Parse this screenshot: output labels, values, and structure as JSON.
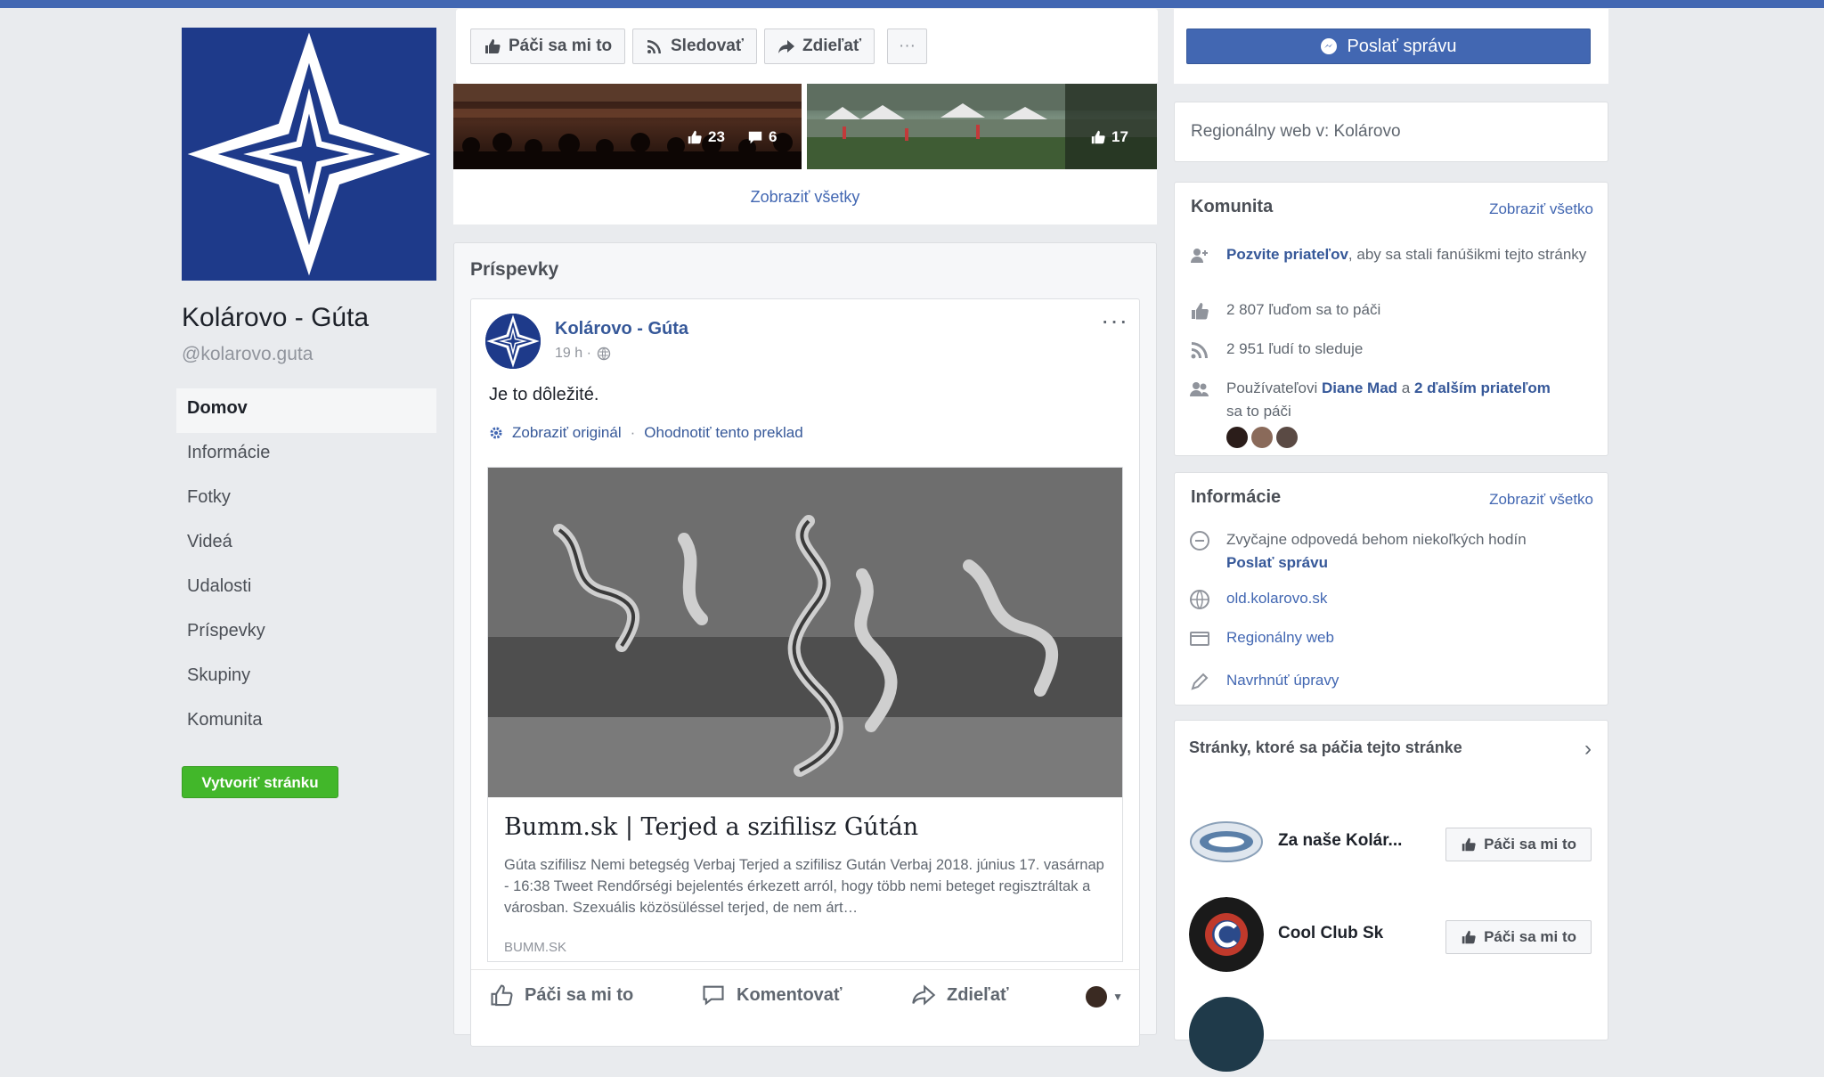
{
  "colors": {
    "accent": "#4267b2",
    "link": "#365899",
    "create_button": "#42b72a",
    "background": "#e9ebee"
  },
  "page": {
    "name": "Kolárovo - Gúta",
    "handle": "@kolarovo.guta",
    "create_page_label": "Vytvoriť stránku"
  },
  "sidebar": {
    "items": [
      {
        "label": "Domov",
        "active": true
      },
      {
        "label": "Informácie"
      },
      {
        "label": "Fotky"
      },
      {
        "label": "Videá"
      },
      {
        "label": "Udalosti"
      },
      {
        "label": "Príspevky"
      },
      {
        "label": "Skupiny"
      },
      {
        "label": "Komunita"
      }
    ]
  },
  "action_bar": {
    "like_label": "Páči sa mi to",
    "follow_label": "Sledovať",
    "share_label": "Zdieľať",
    "more_label": "···",
    "message_label": "Poslať správu"
  },
  "photos": {
    "items": [
      {
        "likes": "23",
        "comments": "6"
      },
      {
        "likes": "17"
      }
    ],
    "see_all": "Zobraziť všetky"
  },
  "posts": {
    "title": "Príspevky",
    "post": {
      "author": "Kolárovo - Gúta",
      "time": "19 h ·",
      "text": "Je to dôležité.",
      "show_original": "Zobraziť originál",
      "rate_translation": "Ohodnotiť tento preklad",
      "link_title": "Bumm.sk | Terjed a szifilisz Gútán",
      "link_description": "Gúta szifilisz Nemi betegség Verbaj Terjed a szifilisz Gután Verbaj 2018. június 17. vasárnap - 16:38 Tweet Rendőrségi bejelentés érkezett arról, hogy több nemi beteget regisztráltak a városban. Szexuális közösüléssel terjed, de nem árt…",
      "link_domain": "BUMM.SK",
      "like_label": "Páči sa mi to",
      "comment_label": "Komentovať",
      "share_label": "Zdieľať",
      "more_label": "···"
    }
  },
  "right": {
    "category": "Regionálny web v: Kolárovo",
    "community": {
      "title": "Komunita",
      "see_all": "Zobraziť všetko",
      "invite_link": "Pozvite priateľov",
      "invite_rest": ", aby sa stali fanúšikmi tejto stránky",
      "likes": "2 807 ľuďom sa to páči",
      "follows": "2 951 ľudí to sleduje",
      "friends_prefix": "Používateľovi ",
      "friends_name": "Diane Mad",
      "friends_mid": " a ",
      "friends_more": "2 ďalším priateľom",
      "friends_suffix": "sa to páči"
    },
    "info": {
      "title": "Informácie",
      "see_all": "Zobraziť všetko",
      "response": "Zvyčajne odpovedá behom niekoľkých hodín",
      "send_message": "Poslať správu",
      "website": "old.kolarovo.sk",
      "category": "Regionálny web",
      "suggest": "Navrhnúť úpravy"
    },
    "liked_pages": {
      "title": "Stránky, ktoré sa páčia tejto stránke",
      "like_label": "Páči sa mi to",
      "items": [
        {
          "name": "Za naše Kolár..."
        },
        {
          "name": "Cool Club Sk"
        }
      ]
    }
  }
}
